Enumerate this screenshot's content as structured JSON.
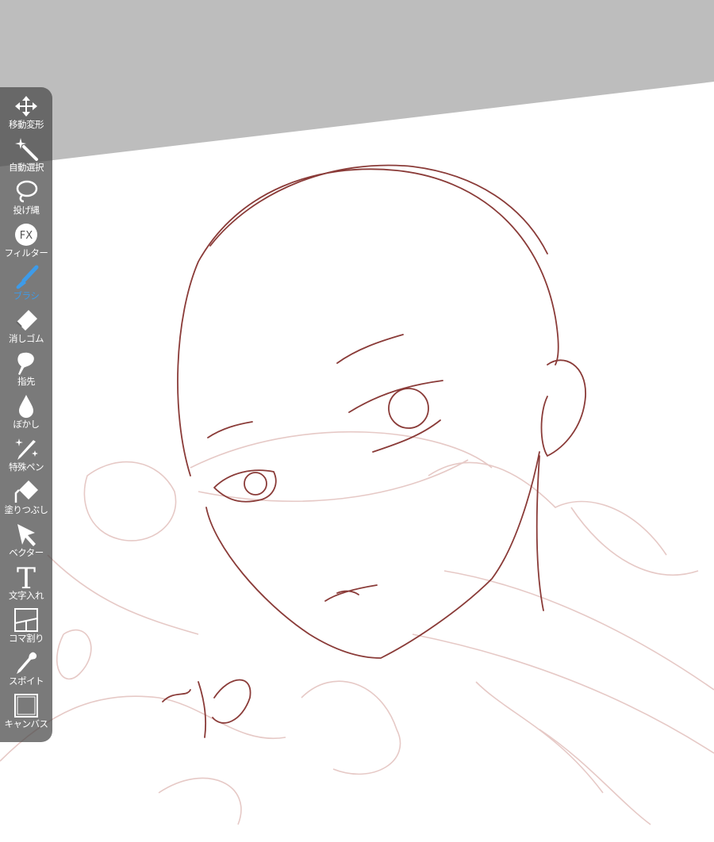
{
  "toolbar": {
    "active": "brush",
    "active_color": "#3d9be9",
    "tools": [
      {
        "id": "move",
        "label": "移動変形",
        "icon": "move-arrows-icon"
      },
      {
        "id": "magic",
        "label": "自動選択",
        "icon": "magic-wand-icon"
      },
      {
        "id": "lasso",
        "label": "投げ縄",
        "icon": "lasso-icon"
      },
      {
        "id": "filter",
        "label": "フィルター",
        "icon": "fx-icon"
      },
      {
        "id": "brush",
        "label": "ブラシ",
        "icon": "brush-icon"
      },
      {
        "id": "eraser",
        "label": "消しゴム",
        "icon": "eraser-icon"
      },
      {
        "id": "smudge",
        "label": "指先",
        "icon": "finger-smudge-icon"
      },
      {
        "id": "blur",
        "label": "ぼかし",
        "icon": "droplet-icon"
      },
      {
        "id": "special",
        "label": "特殊ペン",
        "icon": "sparkle-pen-icon"
      },
      {
        "id": "fill",
        "label": "塗りつぶし",
        "icon": "bucket-fill-icon"
      },
      {
        "id": "vector",
        "label": "ベクター",
        "icon": "arrow-cursor-icon"
      },
      {
        "id": "text",
        "label": "文字入れ",
        "icon": "text-t-icon"
      },
      {
        "id": "frame",
        "label": "コマ割り",
        "icon": "panel-divide-icon"
      },
      {
        "id": "eyedropper",
        "label": "スポイト",
        "icon": "eyedropper-icon"
      },
      {
        "id": "canvas",
        "label": "キャンバス",
        "icon": "canvas-frame-icon"
      }
    ]
  }
}
